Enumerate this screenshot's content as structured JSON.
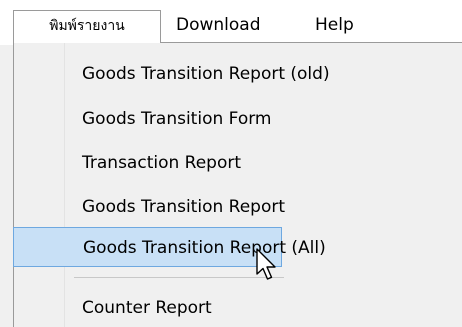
{
  "menubar": {
    "items": [
      {
        "label": "พิมพ์รายงาน"
      },
      {
        "label": "Download"
      },
      {
        "label": "Help"
      }
    ]
  },
  "dropdown": {
    "items": [
      {
        "label": "Goods Transition Report (old)"
      },
      {
        "label": "Goods Transition Form"
      },
      {
        "label": "Transaction Report"
      },
      {
        "label": "Goods Transition Report"
      },
      {
        "label": "Goods Transition Report (All)"
      },
      {
        "label": "Counter Report"
      }
    ],
    "highlighted_index": 4
  },
  "colors": {
    "highlight_fill": "#c8e0f6",
    "highlight_border": "#6ea8e0",
    "menu_background": "#f0f0f0",
    "menubar_background": "#ffffff"
  },
  "cursor": {
    "icon": "mouse-pointer-icon"
  }
}
